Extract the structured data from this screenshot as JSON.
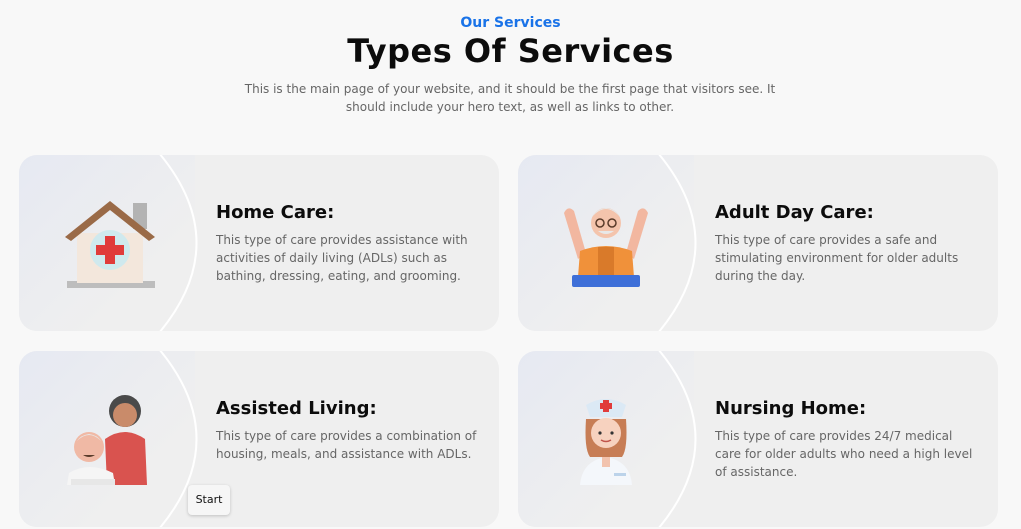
{
  "header": {
    "eyebrow": "Our Services",
    "title": "Types Of Services",
    "subtitle": "This is the main page of your website, and it should be the first page that visitors see. It should include your hero text, as well as links to other."
  },
  "services": [
    {
      "title": "Home Care:",
      "description": "This type of care provides assistance with activities of daily living (ADLs) such as bathing, dressing, eating, and grooming.",
      "icon": "house-medical-icon"
    },
    {
      "title": "Adult Day Care:",
      "description": "This type of care provides a safe and stimulating environment for older adults during the day.",
      "icon": "elderly-man-icon"
    },
    {
      "title": "Assisted Living:",
      "description": "This type of care provides a combination of housing, meals, and assistance with ADLs.",
      "icon": "caregiver-elderly-icon"
    },
    {
      "title": "Nursing Home:",
      "description": "This type of care provides 24/7 medical care for older adults who need a high level of assistance.",
      "icon": "nurse-icon"
    }
  ],
  "taskbar": {
    "start_label": "Start"
  },
  "colors": {
    "accent": "#1a73e8",
    "card_bg": "#efefef",
    "page_bg": "#f8f8f8"
  }
}
